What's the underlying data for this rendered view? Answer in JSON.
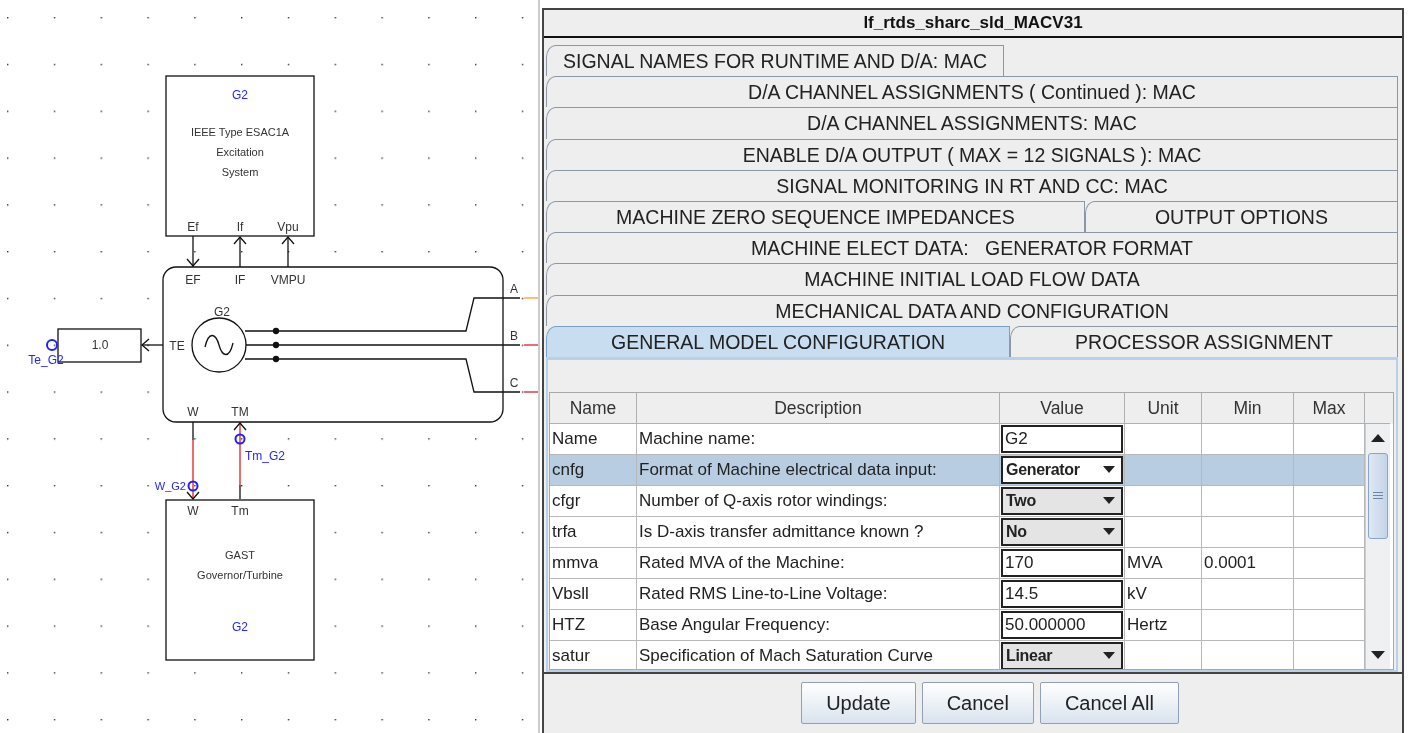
{
  "diagram": {
    "exciter": {
      "id": "G2",
      "title": [
        "IEEE Type ESAC1A",
        "Excitation",
        "System"
      ],
      "ports": [
        "Ef",
        "If",
        "Vpu"
      ]
    },
    "machine": {
      "ports_top": [
        "EF",
        "IF",
        "VMPU"
      ],
      "source_label": "G2",
      "torque_port": "TE",
      "phases": [
        "A",
        "B",
        "C"
      ],
      "ports_bottom": [
        "W",
        "TM"
      ]
    },
    "gain": {
      "value": "1.0",
      "signal": "Te_G2"
    },
    "signals": {
      "tm": "Tm_G2",
      "w": "W_G2"
    },
    "governor": {
      "ports": [
        "W",
        "Tm"
      ],
      "title": [
        "GAST",
        "Governor/Turbine"
      ],
      "id": "G2"
    }
  },
  "dialog": {
    "title": "lf_rtds_sharc_sld_MACV31",
    "tab_rows": [
      [
        {
          "label": "SIGNAL NAMES FOR RUNTIME AND D/A: MAC",
          "selected": false
        }
      ],
      [
        {
          "label": "D/A CHANNEL ASSIGNMENTS ( Continued ): MAC",
          "selected": false
        }
      ],
      [
        {
          "label": "D/A CHANNEL ASSIGNMENTS: MAC",
          "selected": false
        }
      ],
      [
        {
          "label": "ENABLE D/A OUTPUT ( MAX = 12 SIGNALS ): MAC",
          "selected": false
        }
      ],
      [
        {
          "label": "SIGNAL MONITORING IN RT AND CC: MAC",
          "selected": false
        }
      ],
      [
        {
          "label": "MACHINE ZERO SEQUENCE IMPEDANCES",
          "selected": false
        },
        {
          "label": "OUTPUT OPTIONS",
          "selected": false
        }
      ],
      [
        {
          "label": "MACHINE ELECT DATA:   GENERATOR FORMAT",
          "selected": false
        }
      ],
      [
        {
          "label": "MACHINE INITIAL LOAD FLOW DATA",
          "selected": false
        }
      ],
      [
        {
          "label": "MECHANICAL DATA AND CONFIGURATION",
          "selected": false
        }
      ],
      [
        {
          "label": "GENERAL MODEL CONFIGURATION",
          "selected": true
        },
        {
          "label": "PROCESSOR ASSIGNMENT",
          "selected": false
        }
      ]
    ],
    "table": {
      "columns": [
        "Name",
        "Description",
        "Value",
        "Unit",
        "Min",
        "Max"
      ],
      "rows": [
        {
          "name": "Name",
          "description": "Machine name:",
          "value": "G2",
          "kind": "text",
          "selected": false
        },
        {
          "name": "cnfg",
          "description": "Format of Machine electrical data input:",
          "value": "Generator",
          "kind": "combo",
          "selected": true
        },
        {
          "name": "cfgr",
          "description": "Number of Q-axis rotor windings:",
          "value": "Two",
          "kind": "combo",
          "selected": false
        },
        {
          "name": "trfa",
          "description": "Is D-axis transfer admittance known ?",
          "value": "No",
          "kind": "combo",
          "selected": false
        },
        {
          "name": "mmva",
          "description": "Rated MVA of the Machine:",
          "value": "170",
          "kind": "text",
          "unit": "MVA",
          "min": "0.0001",
          "selected": false
        },
        {
          "name": "Vbsll",
          "description": "Rated RMS Line-to-Line Voltage:",
          "value": "14.5",
          "kind": "text",
          "unit": "kV",
          "selected": false
        },
        {
          "name": "HTZ",
          "description": "Base Angular Frequency:",
          "value": "50.000000",
          "kind": "text",
          "unit": "Hertz",
          "selected": false
        },
        {
          "name": "satur",
          "description": "Specification of Mach Saturation Curve",
          "value": "Linear",
          "kind": "combo",
          "selected": false
        }
      ]
    },
    "buttons": [
      "Update",
      "Cancel",
      "Cancel All"
    ]
  }
}
